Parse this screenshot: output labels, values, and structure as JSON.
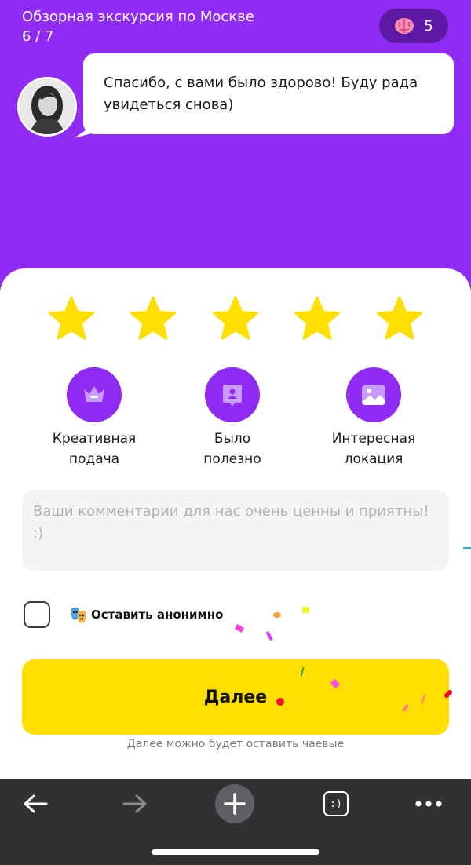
{
  "header": {
    "tour_title": "Обзорная экскурсия по Москве",
    "progress": "6 / 7",
    "brain_count": "5",
    "brain_icon": "brain-icon"
  },
  "chat": {
    "message": "Спасибо, с вами было здорово! Буду рада увидеться снова)",
    "avatar_icon": "guide-avatar"
  },
  "rating": {
    "max": 5,
    "selected": 5,
    "star_color": "#ffdf00"
  },
  "features": [
    {
      "label_line1": "Креативная",
      "label_line2": "подача",
      "icon": "crown-icon"
    },
    {
      "label_line1": "Было",
      "label_line2": "полезно",
      "icon": "badge-person-icon"
    },
    {
      "label_line1": "Интересная",
      "label_line2": "локация",
      "icon": "image-icon"
    }
  ],
  "comment": {
    "placeholder": "Ваши комментарии для нас очень ценны и приятны! :)"
  },
  "anonymous": {
    "label": "Оставить анонимно",
    "checked": false,
    "icon": "theater-masks-icon"
  },
  "next_button": {
    "label": "Далее"
  },
  "tip_note": "Далее можно будет оставить чаевые",
  "browser": {
    "back_icon": "arrow-left-icon",
    "forward_icon": "arrow-right-icon",
    "new_tab_icon": "plus-icon",
    "tabs_label": ":)",
    "menu_icon": "more-horizontal-icon"
  },
  "colors": {
    "brand_purple": "#8f2bf2",
    "accent_yellow": "#ffdf00",
    "badge_dark": "#5d18a6",
    "browser_bar": "#303133"
  }
}
